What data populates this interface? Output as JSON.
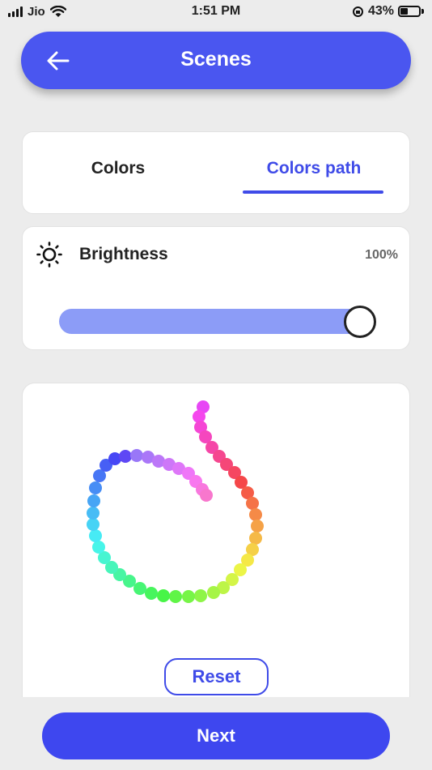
{
  "status_bar": {
    "carrier": "Jio",
    "time": "1:51 PM",
    "battery_percent": "43%",
    "battery_level": 0.43,
    "icons": [
      "signal-icon",
      "wifi-icon",
      "rotation-lock-icon",
      "battery-icon"
    ]
  },
  "header": {
    "title": "Scenes",
    "back_icon": "back-arrow-icon",
    "color": "#4a56f0"
  },
  "tabs": [
    {
      "label": "Colors",
      "selected": false
    },
    {
      "label": "Colors path",
      "selected": true
    }
  ],
  "brightness": {
    "icon": "sun-icon",
    "label": "Brightness",
    "value_text": "100%",
    "value": 1.0,
    "track_color": "#8c9cf7"
  },
  "color_path": {
    "dot_count": 56,
    "hue_start": 295,
    "hue_end": 320
  },
  "reset_label": "Reset",
  "next_label": "Next",
  "accent_color": "#3e47ef"
}
